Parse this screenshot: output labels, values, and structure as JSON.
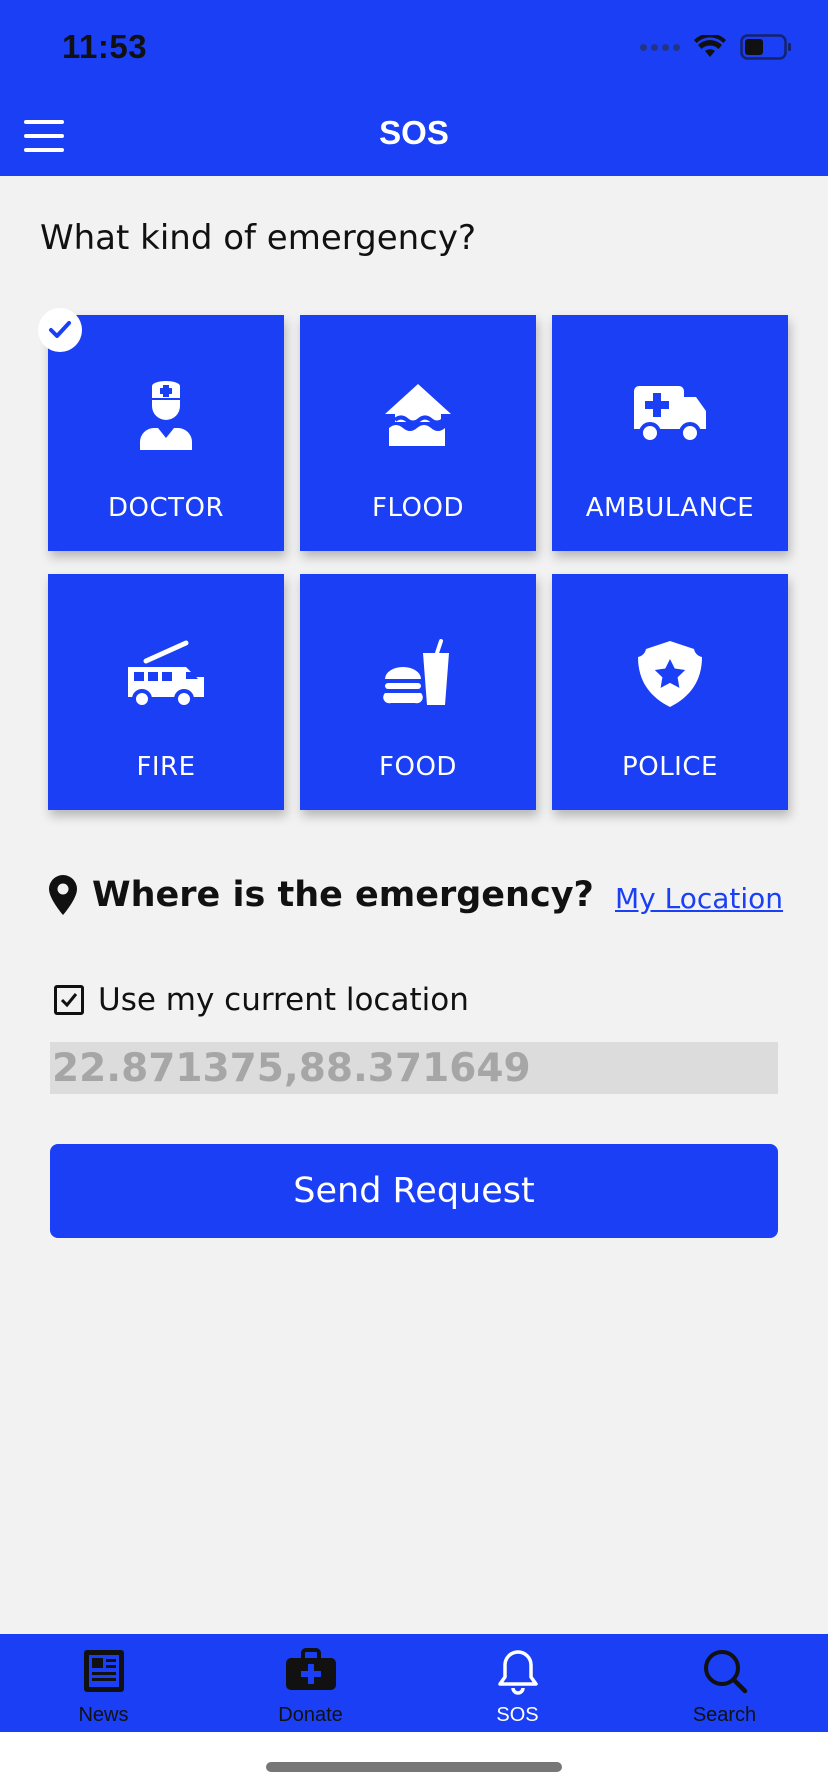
{
  "status": {
    "time": "11:53"
  },
  "header": {
    "title": "SOS"
  },
  "emergency": {
    "question": "What kind of emergency?",
    "tiles": [
      {
        "label": "DOCTOR",
        "icon": "doctor-icon",
        "selected": true
      },
      {
        "label": "FLOOD",
        "icon": "flood-icon",
        "selected": false
      },
      {
        "label": "AMBULANCE",
        "icon": "ambulance-icon",
        "selected": false
      },
      {
        "label": "FIRE",
        "icon": "fire-truck-icon",
        "selected": false
      },
      {
        "label": "FOOD",
        "icon": "food-icon",
        "selected": false
      },
      {
        "label": "POLICE",
        "icon": "police-badge-icon",
        "selected": false
      }
    ]
  },
  "location": {
    "title": "Where is the emergency?",
    "my_location_link": "My Location",
    "use_current_label": "Use my current location",
    "use_current_checked": true,
    "coordinates": "22.871375,88.371649"
  },
  "actions": {
    "send_label": "Send Request"
  },
  "tabs": [
    {
      "label": "News",
      "icon": "newspaper-icon",
      "active": false
    },
    {
      "label": "Donate",
      "icon": "medical-kit-icon",
      "active": false
    },
    {
      "label": "SOS",
      "icon": "bell-icon",
      "active": true
    },
    {
      "label": "Search",
      "icon": "search-icon",
      "active": false
    }
  ],
  "colors": {
    "primary": "#1a3ff5",
    "background": "#f2f2f2",
    "tab_active": "#ffffff",
    "tab_inactive": "#111111"
  }
}
